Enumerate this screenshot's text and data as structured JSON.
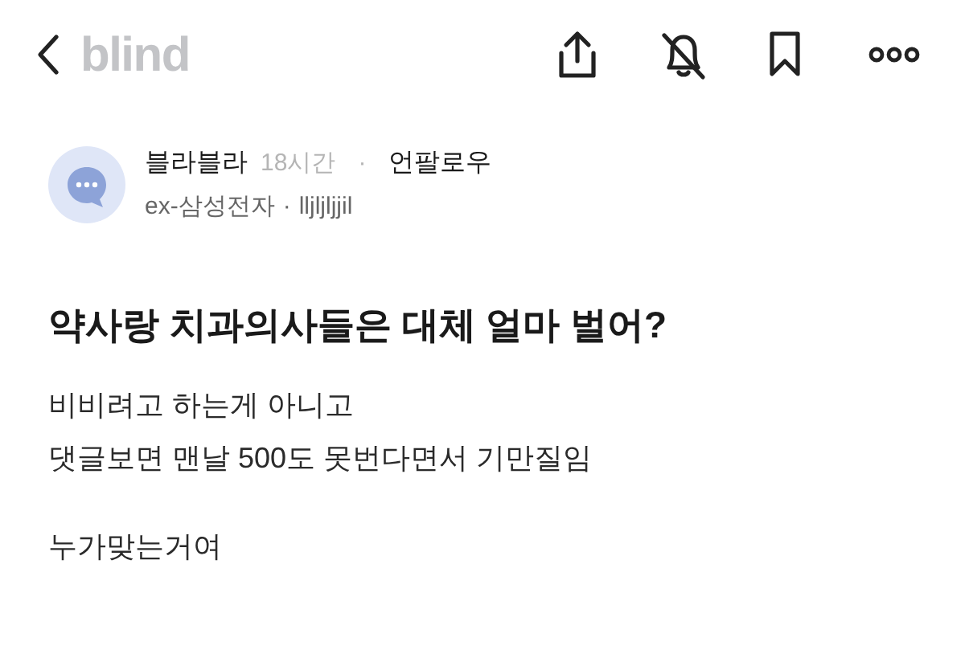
{
  "header": {
    "logo": "blind"
  },
  "author": {
    "name": "블라블라",
    "time": "18시간",
    "separator": "·",
    "follow": "언팔로우",
    "company": "ex-삼성전자",
    "company_separator": "·",
    "nickname": "lljljljjil"
  },
  "post": {
    "title": "약사랑 치과의사들은 대체 얼마 벌어?",
    "paragraphs": [
      [
        "비비려고 하는게 아니고",
        "댓글보면 맨날 500도 못번다면서 기만질임"
      ],
      [
        "누가맞는거여"
      ]
    ]
  }
}
